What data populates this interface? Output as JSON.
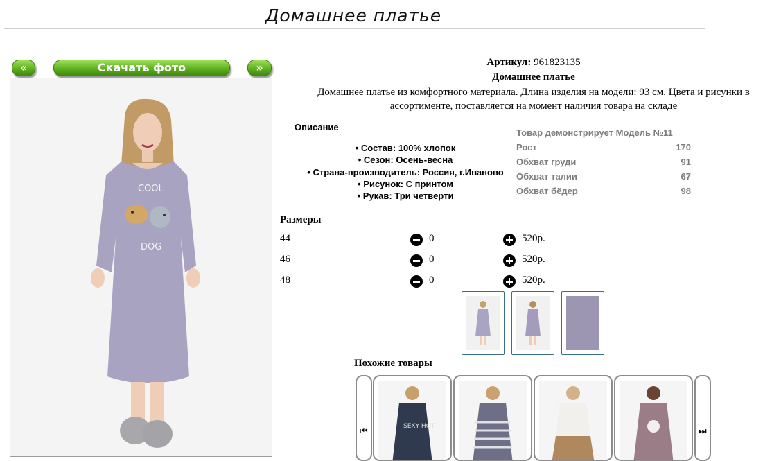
{
  "page": {
    "title": "Домашнее платье"
  },
  "gallery": {
    "prev_label": "«",
    "download_label": "Скачать фото",
    "next_label": "»"
  },
  "product": {
    "sku_label": "Артикул:",
    "sku_value": "961823135",
    "name": "Домашнее платье",
    "description": "Домашнее платье из комфортного материала. Длина изделия на модели: 93 см. Цвета и рисунки в ассортименте, поставляется на момент наличия товара на складе"
  },
  "specs": {
    "heading": "Описание",
    "items": [
      "Состав: 100% хлопок",
      "Сезон: Осень-весна",
      "Страна-производитель: Россия, г.Иваново",
      "Рисунок: С принтом",
      "Рукав: Три четверти"
    ]
  },
  "model": {
    "heading": "Товар демонстрирует Модель №11",
    "rows": [
      {
        "label": "Рост",
        "value": "170"
      },
      {
        "label": "Обхват груди",
        "value": "91"
      },
      {
        "label": "Обхват талии",
        "value": "67"
      },
      {
        "label": "Обхват бёдер",
        "value": "98"
      }
    ]
  },
  "sizes": {
    "heading": "Размеры",
    "rows": [
      {
        "size": "44",
        "qty": "0",
        "price": "520р."
      },
      {
        "size": "46",
        "qty": "0",
        "price": "520р."
      },
      {
        "size": "48",
        "qty": "0",
        "price": "520р."
      }
    ]
  },
  "print_text": {
    "line1": "COOL",
    "line2": "DOG"
  },
  "similar": {
    "heading": "Похожие товары",
    "card1_print": "SEXY HOT"
  },
  "icons": {
    "minus": "minus-circle-icon",
    "plus": "plus-circle-icon",
    "nav_prev": "skip-back-icon",
    "nav_next": "skip-forward-icon"
  },
  "colors": {
    "button_green": "#5fb01f",
    "dress_lavender": "#a9a3c2"
  }
}
